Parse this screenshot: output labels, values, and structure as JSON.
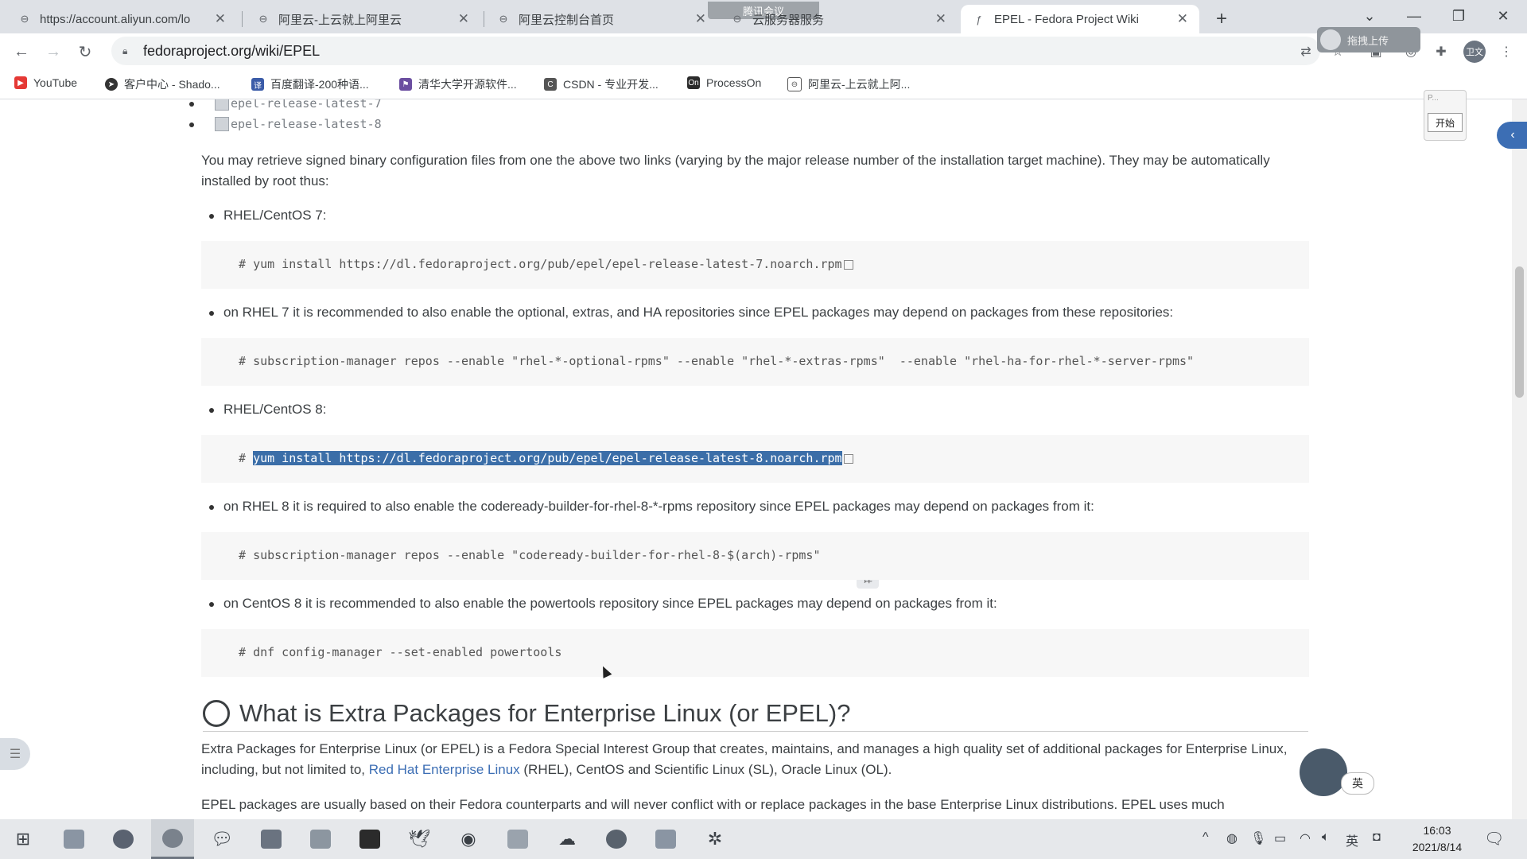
{
  "browser": {
    "tabs": [
      {
        "title": "https://account.aliyun.com/lo",
        "icon": "link-icon"
      },
      {
        "title": "阿里云-上云就上阿里云",
        "icon": "link-icon"
      },
      {
        "title": "阿里云控制台首页",
        "icon": "link-icon"
      },
      {
        "title": "云服务器服务",
        "icon": "link-icon"
      },
      {
        "title": "EPEL - Fedora Project Wiki",
        "icon": "fedora-icon",
        "active": true
      }
    ],
    "meeting_banner": "腾讯会议",
    "url": "fedoraproject.org/wiki/EPEL",
    "overlay_button": "拖拽上传",
    "profile_initials": "卫文",
    "bookmarks": [
      {
        "label": "YouTube",
        "color": "#e53935"
      },
      {
        "label": "客户中心 - Shado...",
        "color": "#333333"
      },
      {
        "label": "百度翻译-200种语...",
        "color": "#3b5ca8"
      },
      {
        "label": "清华大学开源软件...",
        "color": "#6b4ea0"
      },
      {
        "label": "CSDN - 专业开发...",
        "color": "#555555"
      },
      {
        "label": "ProcessOn",
        "color": "#2b2b2b"
      },
      {
        "label": "阿里云-上云就上阿...",
        "color": "#555555"
      }
    ]
  },
  "page": {
    "release_links": [
      "epel-release-latest-7",
      "epel-release-latest-8"
    ],
    "intro": "You may retrieve signed binary configuration files from one the above two links (varying by the major release number of the installation target machine). They may be automatically installed by root thus:",
    "sections": [
      {
        "bullet": "RHEL/CentOS 7:",
        "code_prefix": "# ",
        "code": "yum install https://dl.fedoraproject.org/pub/epel/epel-release-latest-7.noarch.rpm",
        "selected": false
      },
      {
        "bullet": "on RHEL 7 it is recommended to also enable the optional, extras, and HA repositories since EPEL packages may depend on packages from these repositories:",
        "code_prefix": "# ",
        "code": "subscription-manager repos --enable \"rhel-*-optional-rpms\" --enable \"rhel-*-extras-rpms\"  --enable \"rhel-ha-for-rhel-*-server-rpms\"",
        "selected": false
      },
      {
        "bullet": "RHEL/CentOS 8:",
        "code_prefix": "# ",
        "code": "yum install https://dl.fedoraproject.org/pub/epel/epel-release-latest-8.noarch.rpm",
        "selected": true
      },
      {
        "bullet": "on RHEL 8 it is required to also enable the codeready-builder-for-rhel-8-*-rpms repository since EPEL packages may depend on packages from it:",
        "code_prefix": "# ",
        "code": "subscription-manager repos --enable \"codeready-builder-for-rhel-8-$(arch)-rpms\"",
        "selected": false
      },
      {
        "bullet": "on CentOS 8 it is recommended to also enable the powertools repository since EPEL packages may depend on packages from it:",
        "code_prefix": "# ",
        "code": "dnf config-manager --set-enabled powertools",
        "selected": false
      }
    ],
    "heading": "What is Extra Packages for Enterprise Linux (or EPEL)?",
    "para1_pre": "Extra Packages for Enterprise Linux (or EPEL) is a Fedora Special Interest Group that creates, maintains, and manages a high quality set of additional packages for Enterprise Linux, including, but not limited to, ",
    "para1_link": "Red Hat Enterprise Linux",
    "para1_post": " (RHEL), CentOS and Scientific Linux (SL), Oracle Linux (OL).",
    "para2": "EPEL packages are usually based on their Fedora counterparts and will never conflict with or replace packages in the base Enterprise Linux distributions. EPEL uses much"
  },
  "overlays": {
    "float_panel_top": "P...",
    "float_panel_button": "开始",
    "ime_lang": "英"
  },
  "taskbar": {
    "tray_lang": "英",
    "time": "16:03",
    "date": "2021/8/14"
  }
}
